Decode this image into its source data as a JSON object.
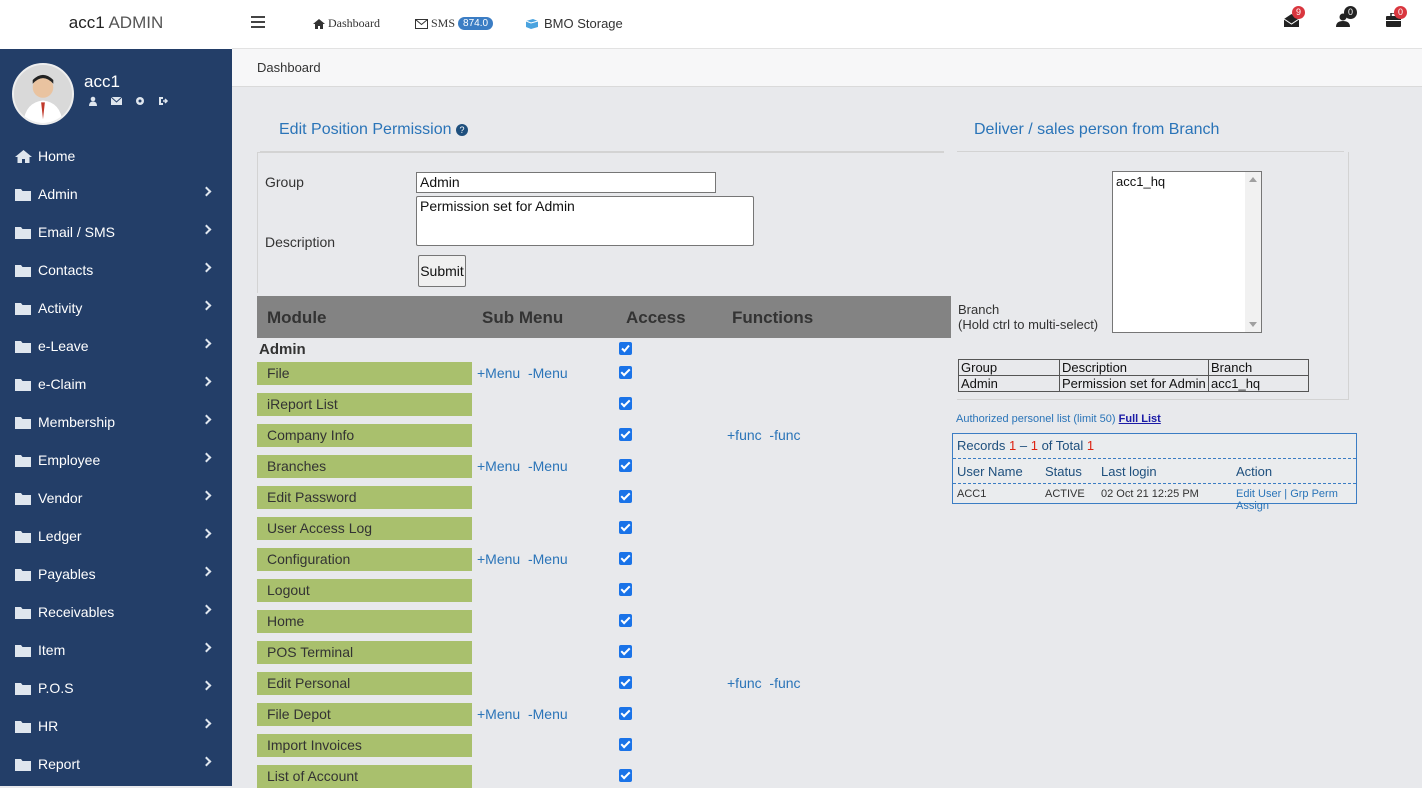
{
  "brand": {
    "bold": "acc1",
    "rest": " ADMIN"
  },
  "user": {
    "name": "acc1",
    "icons": [
      "user-icon",
      "envelope-icon",
      "gear-icon",
      "sign-out-icon"
    ]
  },
  "sidebar": {
    "items": [
      {
        "label": "Home",
        "icon": "home-icon"
      },
      {
        "label": "Admin",
        "icon": "folder-icon"
      },
      {
        "label": "Email / SMS",
        "icon": "folder-icon"
      },
      {
        "label": "Contacts",
        "icon": "folder-icon"
      },
      {
        "label": "Activity",
        "icon": "folder-icon"
      },
      {
        "label": "e-Leave",
        "icon": "folder-icon"
      },
      {
        "label": "e-Claim",
        "icon": "folder-icon"
      },
      {
        "label": "Membership",
        "icon": "folder-icon"
      },
      {
        "label": "Employee",
        "icon": "folder-icon"
      },
      {
        "label": "Vendor",
        "icon": "folder-icon"
      },
      {
        "label": "Ledger",
        "icon": "folder-icon"
      },
      {
        "label": "Payables",
        "icon": "folder-icon"
      },
      {
        "label": "Receivables",
        "icon": "folder-icon"
      },
      {
        "label": "Item",
        "icon": "folder-icon"
      },
      {
        "label": "P.O.S",
        "icon": "folder-icon"
      },
      {
        "label": "HR",
        "icon": "folder-icon"
      },
      {
        "label": "Report",
        "icon": "folder-icon"
      }
    ]
  },
  "topbar": {
    "dashboard": "Dashboard",
    "sms": "SMS",
    "sms_badge": "874.0",
    "storage": "BMO Storage",
    "mail_count": "9",
    "user_count": "0",
    "tasks_count": "0"
  },
  "breadcrumb": "Dashboard",
  "edit": {
    "title": "Edit Position Permission",
    "group_label": "Group",
    "group_value": "Admin",
    "desc_label": "Description",
    "desc_value": "Permission set for Admin",
    "submit": "Submit"
  },
  "perm_table": {
    "headers": [
      "Module",
      "Sub Menu",
      "Access",
      "Functions"
    ],
    "module_title": "Admin",
    "rows": [
      {
        "name": "File",
        "menu": "+Menu  -Menu",
        "func": ""
      },
      {
        "name": "iReport List",
        "menu": "",
        "func": ""
      },
      {
        "name": "Company Info",
        "menu": "",
        "func": "+func  -func"
      },
      {
        "name": "Branches",
        "menu": "+Menu  -Menu",
        "func": ""
      },
      {
        "name": "Edit Password",
        "menu": "",
        "func": ""
      },
      {
        "name": "User Access Log",
        "menu": "",
        "func": ""
      },
      {
        "name": "Configuration",
        "menu": "+Menu  -Menu",
        "func": ""
      },
      {
        "name": "Logout",
        "menu": "",
        "func": ""
      },
      {
        "name": "Home",
        "menu": "",
        "func": ""
      },
      {
        "name": "POS Terminal",
        "menu": "",
        "func": ""
      },
      {
        "name": "Edit Personal",
        "menu": "",
        "func": "+func  -func"
      },
      {
        "name": "File Depot",
        "menu": "+Menu  -Menu",
        "func": ""
      },
      {
        "name": "Import Invoices",
        "menu": "",
        "func": ""
      },
      {
        "name": "List of Account",
        "menu": "",
        "func": ""
      }
    ]
  },
  "branch_panel": {
    "title": "Deliver / sales person from Branch",
    "branch_label": "Branch",
    "branch_hint": "(Hold ctrl to multi-select)",
    "branch_options": [
      "acc1_hq"
    ],
    "table_headers": [
      "Group",
      "Description",
      "Branch"
    ],
    "table_row": [
      "Admin",
      "Permission set for Admin",
      "acc1_hq"
    ],
    "auth_text": "Authorized personel list (limit 50)",
    "full_list": "Full List",
    "records_prefix": "Records ",
    "records_from": "1",
    "records_dash": " – ",
    "records_to": "1",
    "records_mid": " of Total ",
    "records_total": "1",
    "user_headers": [
      "User Name",
      "Status",
      "Last login",
      "Action"
    ],
    "user_row": {
      "name": "ACC1",
      "status": "ACTIVE",
      "login": "02 Oct 21 12:25 PM",
      "action": "Edit User | Grp Perm Assign"
    }
  },
  "colors": {
    "sidebar": "#233e68",
    "accent": "#2a74b8",
    "module_bg": "#a9c06d",
    "header_bg": "#838383",
    "badge_red": "#d9363e"
  }
}
